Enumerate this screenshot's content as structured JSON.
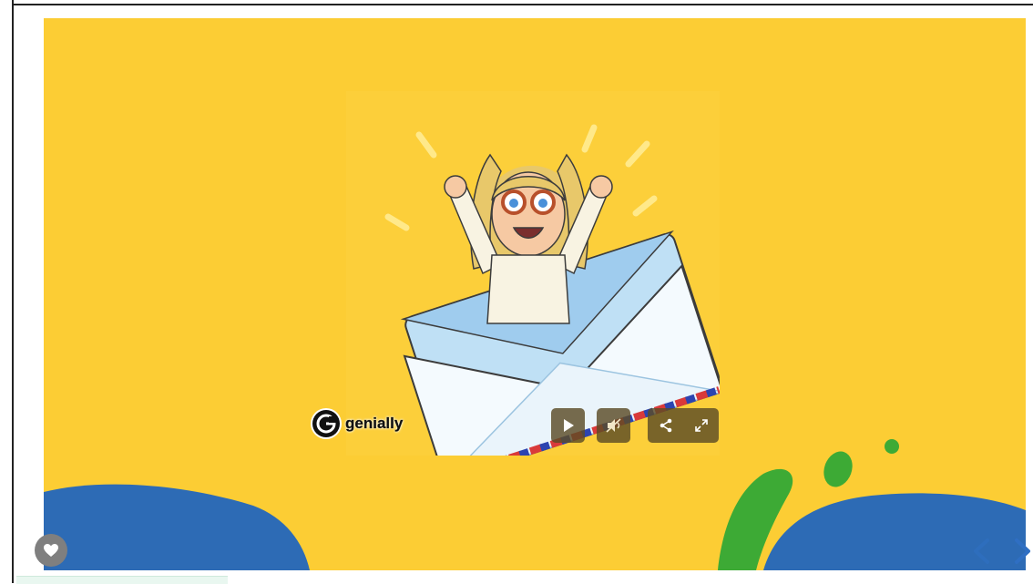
{
  "brand": {
    "name": "genially",
    "colors": {
      "background": "#FCCD34",
      "blue_wave": "#2D6BB5",
      "green_splash": "#3DAA35",
      "control_bg": "#5C4C26"
    }
  },
  "controls": {
    "play": "play-icon",
    "mute": "mute-icon",
    "share": "share-icon",
    "fullscreen": "fullscreen-icon"
  },
  "overlay": {
    "like": "heart-icon",
    "prev": "chevron-left-icon",
    "next": "chevron-right-icon"
  }
}
